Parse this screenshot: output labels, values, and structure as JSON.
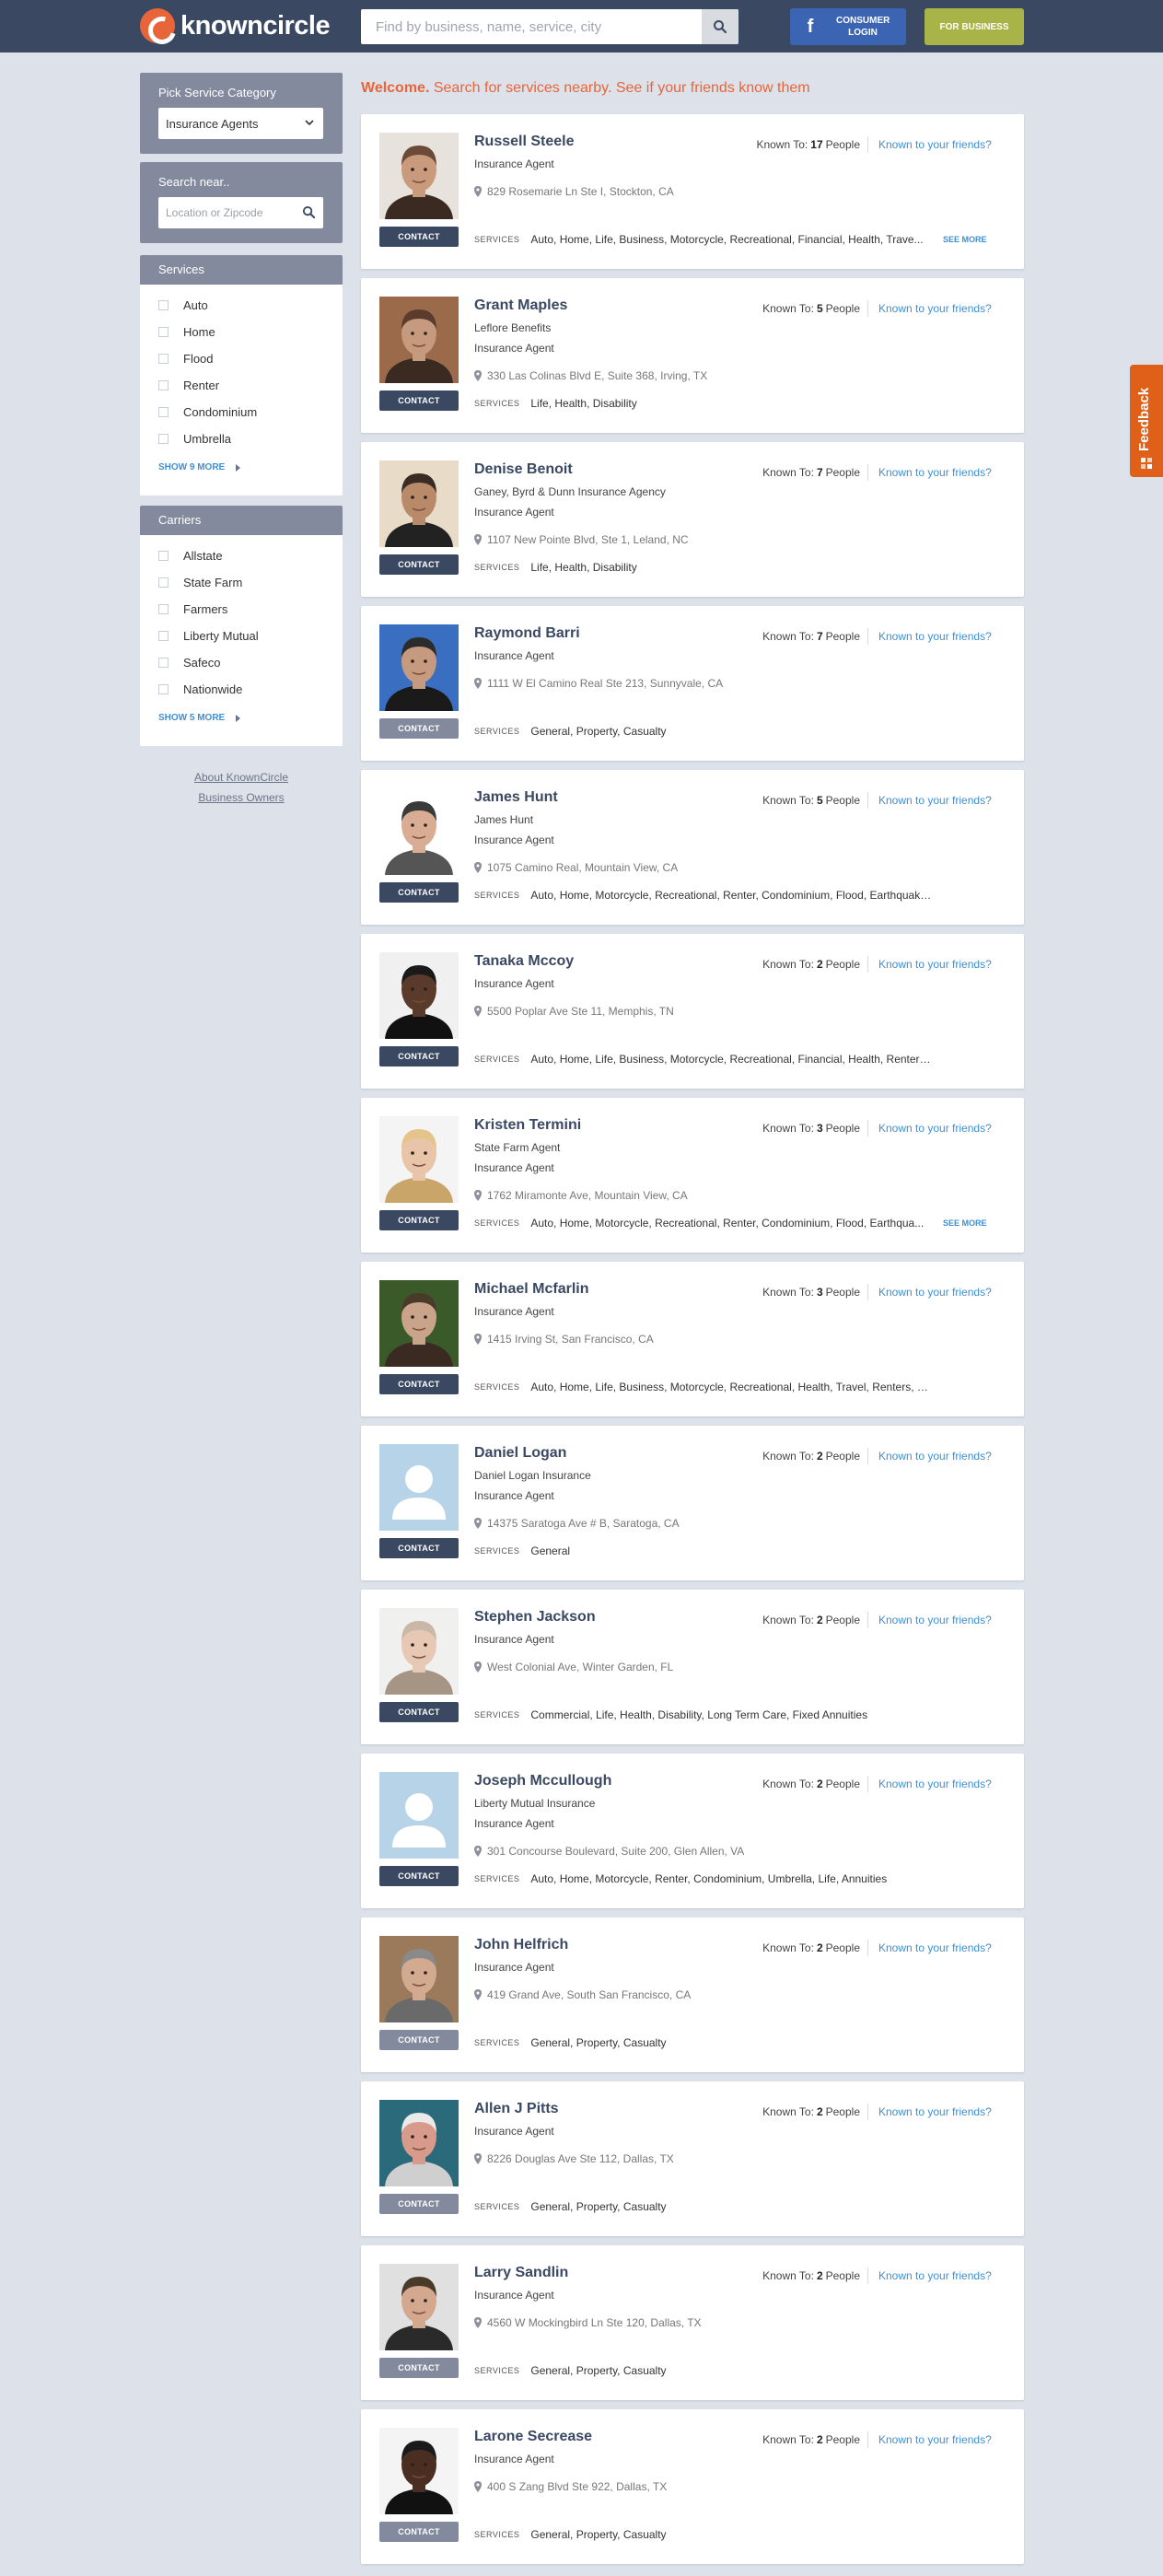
{
  "header": {
    "logo": "knowncircle",
    "search_placeholder": "Find by business, name, service, city",
    "fb_button": "CONSUMER LOGIN",
    "biz_button": "FOR BUSINESS"
  },
  "sidebar": {
    "category_title": "Pick Service Category",
    "category_value": "Insurance Agents",
    "search_near_title": "Search near..",
    "location_placeholder": "Location or Zipcode",
    "services_title": "Services",
    "services": [
      "Auto",
      "Home",
      "Flood",
      "Renter",
      "Condominium",
      "Umbrella"
    ],
    "services_more": "SHOW 9 MORE",
    "carriers_title": "Carriers",
    "carriers": [
      "Allstate",
      "State Farm",
      "Farmers",
      "Liberty Mutual",
      "Safeco",
      "Nationwide"
    ],
    "carriers_more": "SHOW 5 MORE",
    "links": [
      "About KnownCircle",
      "Business Owners"
    ]
  },
  "main": {
    "welcome_bold": "Welcome.",
    "welcome_rest": " Search for services nearby. See if your friends know them",
    "known_label": "Known To:",
    "people_label": "People",
    "friends_link": "Known to your friends?",
    "services_label": "SERVICES",
    "contact_label": "CONTACT",
    "see_more_label": "SEE MORE",
    "agents": [
      {
        "name": "Russell Steele",
        "lines": [
          "Insurance Agent"
        ],
        "address": "829 Rosemarie Ln Ste I, Stockton, CA",
        "known": "17",
        "services": "Auto, Home, Life, Business, Motorcycle, Recreational, Financial, Health, Trave...",
        "see_more": true,
        "muted": false,
        "photo": "tan"
      },
      {
        "name": "Grant Maples",
        "lines": [
          "Leflore Benefits",
          "Insurance Agent"
        ],
        "address": "330 Las Colinas Blvd E, Suite 368, Irving, TX",
        "known": "5",
        "services": "Life, Health, Disability",
        "see_more": false,
        "muted": false,
        "photo": "brown"
      },
      {
        "name": "Denise Benoit",
        "lines": [
          "Ganey, Byrd & Dunn Insurance Agency",
          "Insurance Agent"
        ],
        "address": "1107 New Pointe Blvd, Ste 1, Leland, NC",
        "known": "7",
        "services": "Life, Health, Disability",
        "see_more": false,
        "muted": false,
        "photo": "darkhair"
      },
      {
        "name": "Raymond Barri",
        "lines": [
          "Insurance Agent"
        ],
        "address": "1111 W El Camino Real Ste 213, Sunnyvale, CA",
        "known": "7",
        "services": "General, Property, Casualty",
        "see_more": false,
        "muted": true,
        "photo": "blue"
      },
      {
        "name": "James Hunt",
        "lines": [
          "James Hunt",
          "Insurance Agent"
        ],
        "address": "1075 Camino Real, Mountain View, CA",
        "known": "5",
        "services": "Auto, Home, Motorcycle, Recreational, Renter, Condominium, Flood, Earthquake, Umbrella",
        "see_more": false,
        "muted": false,
        "photo": "light"
      },
      {
        "name": "Tanaka Mccoy",
        "lines": [
          "Insurance Agent"
        ],
        "address": "5500 Poplar Ave Ste 11, Memphis, TN",
        "known": "2",
        "services": "Auto, Home, Life, Business, Motorcycle, Recreational, Financial, Health, Renters, Umbrella",
        "see_more": false,
        "muted": false,
        "photo": "dark"
      },
      {
        "name": "Kristen Termini",
        "lines": [
          "State Farm Agent",
          "Insurance Agent"
        ],
        "address": "1762 Miramonte Ave, Mountain View, CA",
        "known": "3",
        "services": "Auto, Home, Motorcycle, Recreational, Renter, Condominium, Flood, Earthqua...",
        "see_more": true,
        "muted": false,
        "photo": "blonde"
      },
      {
        "name": "Michael Mcfarlin",
        "lines": [
          "Insurance Agent"
        ],
        "address": "1415 Irving St, San Francisco, CA",
        "known": "3",
        "services": "Auto, Home, Life, Business, Motorcycle, Recreational, Health, Travel, Renters, Umbrella",
        "see_more": false,
        "muted": false,
        "photo": "green"
      },
      {
        "name": "Daniel Logan",
        "lines": [
          "Daniel Logan Insurance",
          "Insurance Agent"
        ],
        "address": "14375 Saratoga Ave # B, Saratoga, CA",
        "known": "2",
        "services": "General",
        "see_more": false,
        "muted": false,
        "photo": "placeholder"
      },
      {
        "name": "Stephen Jackson",
        "lines": [
          "Insurance Agent"
        ],
        "address": "West Colonial Ave, Winter Garden, FL",
        "known": "2",
        "services": "Commercial, Life, Health, Disability, Long Term Care, Fixed Annuities",
        "see_more": false,
        "muted": false,
        "photo": "pale"
      },
      {
        "name": "Joseph Mccullough",
        "lines": [
          "Liberty Mutual Insurance",
          "Insurance Agent"
        ],
        "address": "301 Concourse Boulevard, Suite 200, Glen Allen, VA",
        "known": "2",
        "services": "Auto, Home, Motorcycle, Renter, Condominium, Umbrella, Life, Annuities",
        "see_more": false,
        "muted": false,
        "photo": "placeholder"
      },
      {
        "name": "John Helfrich",
        "lines": [
          "Insurance Agent"
        ],
        "address": "419 Grand Ave, South San Francisco, CA",
        "known": "2",
        "services": "General, Property, Casualty",
        "see_more": false,
        "muted": true,
        "photo": "grey"
      },
      {
        "name": "Allen J Pitts",
        "lines": [
          "Insurance Agent"
        ],
        "address": "8226 Douglas Ave Ste 112, Dallas, TX",
        "known": "2",
        "services": "General, Property, Casualty",
        "see_more": false,
        "muted": true,
        "photo": "teal"
      },
      {
        "name": "Larry Sandlin",
        "lines": [
          "Insurance Agent"
        ],
        "address": "4560 W Mockingbird Ln Ste 120, Dallas, TX",
        "known": "2",
        "services": "General, Property, Casualty",
        "see_more": false,
        "muted": true,
        "photo": "suit"
      },
      {
        "name": "Larone Secrease",
        "lines": [
          "Insurance Agent"
        ],
        "address": "400 S Zang Blvd Ste 922, Dallas, TX",
        "known": "2",
        "services": "General, Property, Casualty",
        "see_more": false,
        "muted": true,
        "photo": "darksuit"
      }
    ]
  },
  "feedback": "Feedback",
  "colors": {
    "header": "#3a4862",
    "accent": "#e8653a",
    "link": "#3f8fd2",
    "facebook": "#3b64b3",
    "business": "#a8b448",
    "panel": "#838a9d",
    "feedback": "#e06019"
  }
}
